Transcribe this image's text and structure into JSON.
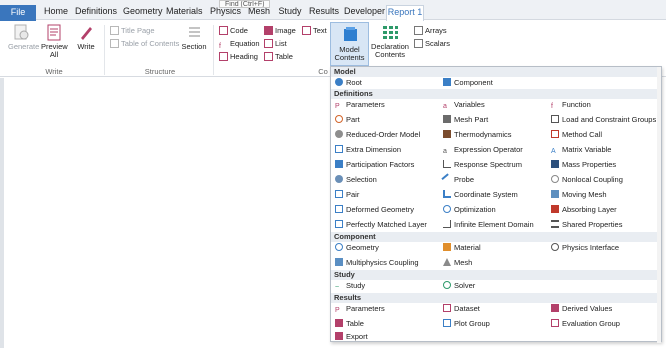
{
  "tabs": [
    {
      "label": "File"
    },
    {
      "label": "Home"
    },
    {
      "label": "Definitions"
    },
    {
      "label": "Geometry"
    },
    {
      "label": "Materials"
    },
    {
      "label": "Physics"
    },
    {
      "label": "Mesh"
    },
    {
      "label": "Study"
    },
    {
      "label": "Results"
    },
    {
      "label": "Developer"
    },
    {
      "label": "Report 1"
    }
  ],
  "tooltip": "Find (Ctrl+F)",
  "ribbon": {
    "write_group": {
      "label": "Write",
      "generate": "Generate",
      "preview": "Preview All",
      "write": "Write"
    },
    "structure_group": {
      "label": "Structure",
      "title_page": "Title Page",
      "toc": "Table of Contents",
      "section": "Section"
    },
    "content_group": {
      "label": "Co",
      "code": "Code",
      "equation": "Equation",
      "heading": "Heading",
      "image": "Image",
      "list": "List",
      "table": "Table",
      "text": "Text"
    },
    "model_contents": "Model Contents",
    "declaration_contents": "Declaration Contents",
    "arrays": "Arrays",
    "scalars": "Scalars"
  },
  "menu": {
    "sections": [
      {
        "title": "Model"
      },
      {
        "title": "Definitions"
      },
      {
        "title": "Component"
      },
      {
        "title": "Study"
      },
      {
        "title": "Results"
      }
    ],
    "model": [
      "Root",
      "Component"
    ],
    "definitions": [
      [
        "Parameters",
        "Variables",
        "Function"
      ],
      [
        "Part",
        "Mesh Part",
        "Load and Constraint Groups"
      ],
      [
        "Reduced-Order Model",
        "Thermodynamics",
        "Method Call"
      ],
      [
        "Extra Dimension",
        "Expression Operator",
        "Matrix Variable"
      ],
      [
        "Participation Factors",
        "Response Spectrum",
        "Mass Properties"
      ],
      [
        "Selection",
        "Probe",
        "Nonlocal Coupling"
      ],
      [
        "Pair",
        "Coordinate System",
        "Moving Mesh"
      ],
      [
        "Deformed Geometry",
        "Optimization",
        "Absorbing Layer"
      ],
      [
        "Perfectly Matched Layer",
        "Infinite Element Domain",
        "Shared Properties"
      ]
    ],
    "component": [
      [
        "Geometry",
        "Material",
        "Physics Interface"
      ],
      [
        "Multiphysics Coupling",
        "Mesh",
        ""
      ]
    ],
    "study": [
      "Study",
      "Solver"
    ],
    "results": [
      [
        "Parameters",
        "Dataset",
        "Derived Values"
      ],
      [
        "Table",
        "Plot Group",
        "Evaluation Group"
      ],
      [
        "Export",
        "",
        ""
      ]
    ]
  },
  "colors": {
    "file_tab": "#3a76bd",
    "active_tab_text": "#3a76bd",
    "model_contents_highlight": "#d8e6f5",
    "menu_header_bg": "#e9edf2"
  }
}
